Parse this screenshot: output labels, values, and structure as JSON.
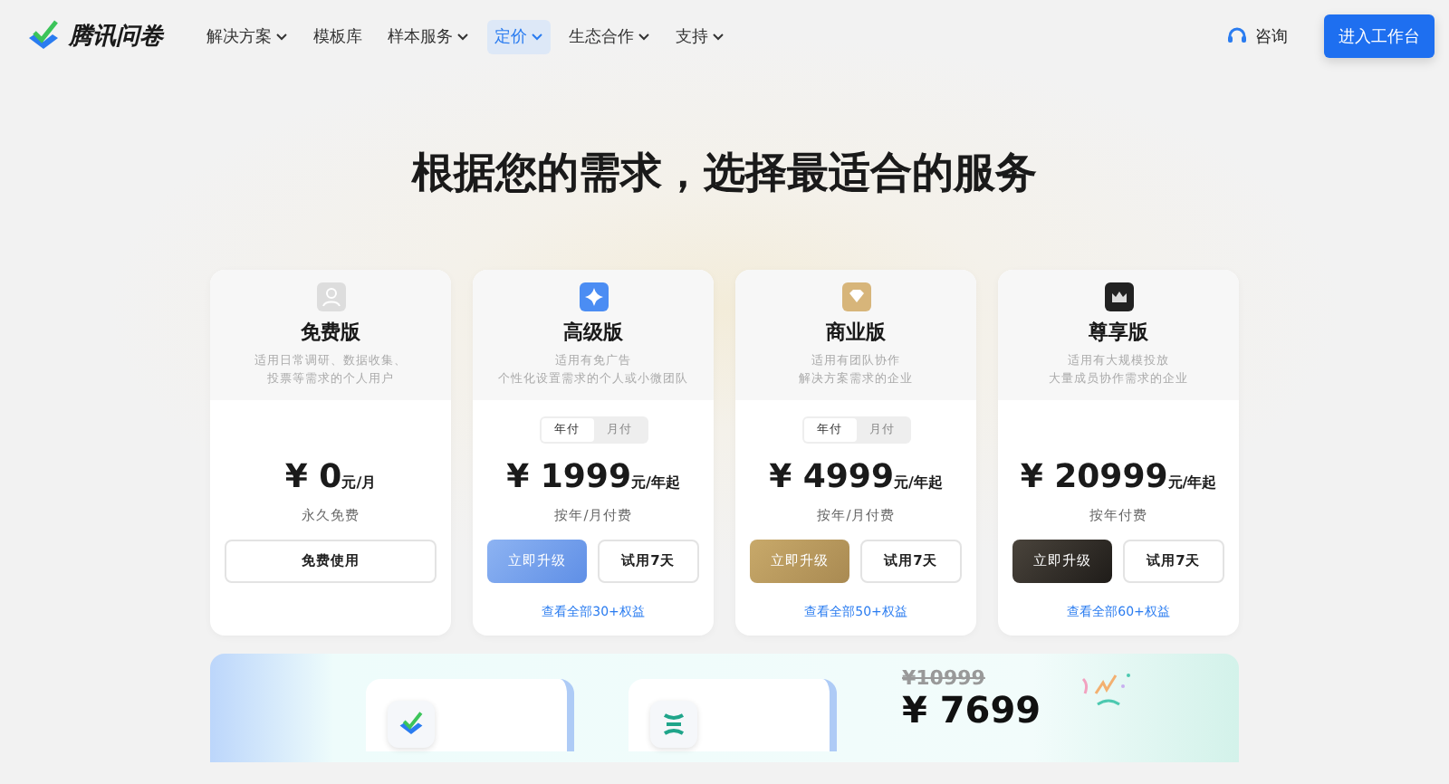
{
  "nav": {
    "brand": "腾讯问卷",
    "items": [
      {
        "label": "解决方案",
        "dropdown": true,
        "selected": false
      },
      {
        "label": "模板库",
        "dropdown": false,
        "selected": false
      },
      {
        "label": "样本服务",
        "dropdown": true,
        "selected": false
      },
      {
        "label": "定价",
        "dropdown": true,
        "selected": true
      },
      {
        "label": "生态合作",
        "dropdown": true,
        "selected": false
      },
      {
        "label": "支持",
        "dropdown": true,
        "selected": false
      }
    ],
    "consult": "咨询",
    "cta": "进入工作台"
  },
  "heading": "根据您的需求，选择最适合的服务",
  "plans": [
    {
      "kind": "free",
      "name": "免费版",
      "desc_lines": [
        "适用日常调研、数据收集、",
        "投票等需求的个人用户"
      ],
      "price": "¥ 0",
      "unit": "元/月",
      "note": "永久免费",
      "buttons": [
        {
          "label": "免费使用",
          "kind": "secondary"
        }
      ]
    },
    {
      "kind": "advanced",
      "name": "高级版",
      "desc_lines": [
        "适用有免广告",
        "个性化设置需求的个人或小微团队"
      ],
      "billing": [
        {
          "label": "年付",
          "selected": true
        },
        {
          "label": "月付",
          "selected": false
        }
      ],
      "price": "¥ 1999",
      "unit": "元/年起",
      "note": "按年/月付费",
      "buttons": [
        {
          "label": "立即升级",
          "kind": "primary"
        },
        {
          "label": "试用7天",
          "kind": "secondary"
        }
      ],
      "link": "查看全部30+权益"
    },
    {
      "kind": "business",
      "name": "商业版",
      "desc_lines": [
        "适用有团队协作",
        "解决方案需求的企业"
      ],
      "billing": [
        {
          "label": "年付",
          "selected": true
        },
        {
          "label": "月付",
          "selected": false
        }
      ],
      "price": "¥ 4999",
      "unit": "元/年起",
      "note": "按年/月付费",
      "buttons": [
        {
          "label": "立即升级",
          "kind": "primary"
        },
        {
          "label": "试用7天",
          "kind": "secondary"
        }
      ],
      "link": "查看全部50+权益"
    },
    {
      "kind": "premium",
      "name": "尊享版",
      "desc_lines": [
        "适用有大规模投放",
        "大量成员协作需求的企业"
      ],
      "price": "¥ 20999",
      "unit": "元/年起",
      "note": "按年付费",
      "buttons": [
        {
          "label": "立即升级",
          "kind": "primary"
        },
        {
          "label": "试用7天",
          "kind": "secondary"
        }
      ],
      "link": "查看全部60+权益"
    }
  ],
  "promo": {
    "old_price": "¥10999",
    "price": "¥ 7699"
  }
}
